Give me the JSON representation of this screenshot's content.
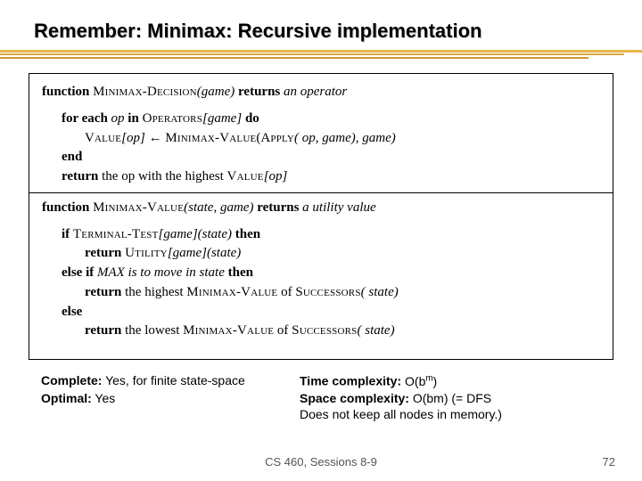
{
  "title": "Remember: Minimax: Recursive implementation",
  "pseudo": {
    "fn1_head_a": "function",
    "fn1_name": "Minimax-Decision",
    "fn1_args": "(game)",
    "returns_kw": "returns",
    "fn1_ret": "an operator",
    "for_kw": "for each",
    "for_op": "op",
    "in_kw": "in",
    "operators": "Operators",
    "game_br": "[game]",
    "do_kw": "do",
    "value_kw": "Value",
    "left_arrow": "←",
    "minimax_value": "Minimax-Value",
    "apply_kw": "Apply",
    "apply_args": "( op, game), game)",
    "end_kw": "end",
    "return_kw": "return",
    "the_op": "the op with the highest",
    "value_op": "[op]",
    "fn2_name": "Minimax-Value",
    "fn2_args": "(state, game)",
    "fn2_ret": "a utility value",
    "if_kw": "if",
    "terminal": "Terminal-Test",
    "state_br": "[game](state)",
    "then_kw": "then",
    "utility": "Utility",
    "elseif_kw": "else if",
    "max_clause": " MAX is to move in state",
    "ret_highest": "the highest",
    "succ": "Successors",
    "succ_args": "( state)",
    "else_kw": "else",
    "ret_lowest": "the lowest"
  },
  "complexity": {
    "complete_lbl": "Complete:",
    "complete_val": "Yes, for finite state-space",
    "optimal_lbl": "Optimal:",
    "optimal_val": "Yes",
    "time_lbl": "Time complexity:",
    "time_val_a": "O(b",
    "time_val_b": "m",
    "time_val_c": ")",
    "space_lbl": "Space complexity:",
    "space_val": "O(bm)   (= DFS",
    "note": "Does not keep all nodes in memory.)"
  },
  "footer": "CS 460, Sessions 8-9",
  "page": "72"
}
